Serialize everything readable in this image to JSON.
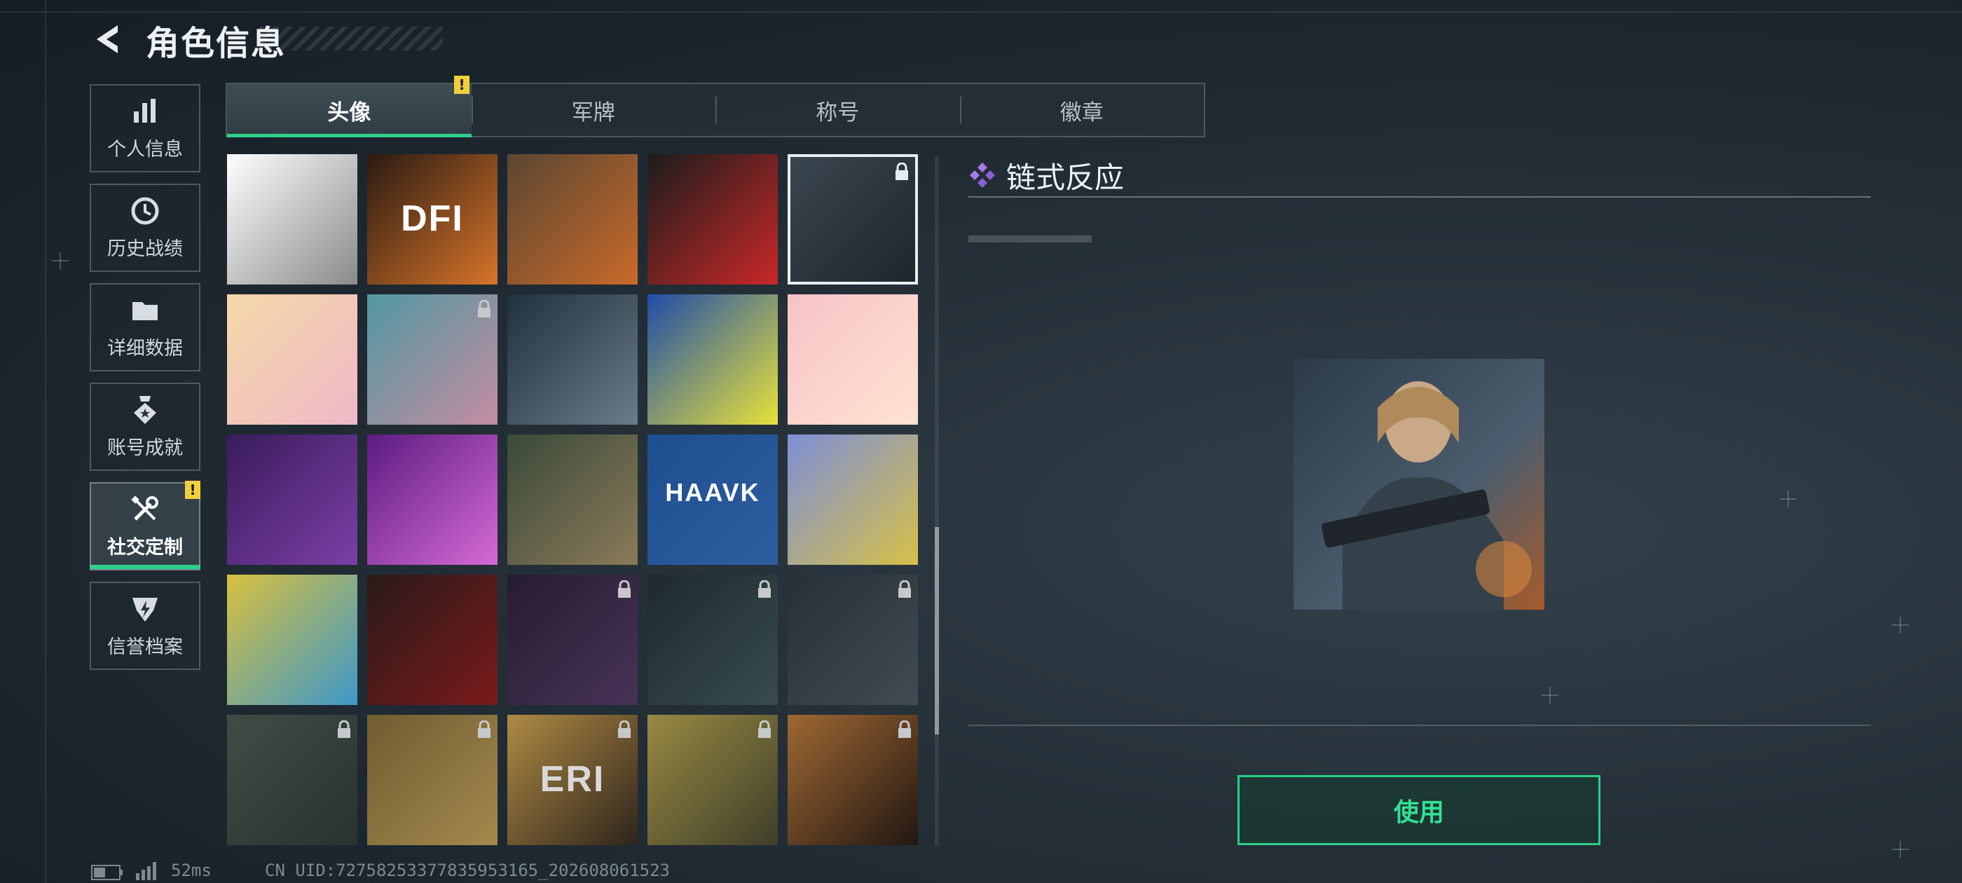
{
  "header": {
    "title": "角色信息",
    "back_icon": "back-arrow-icon"
  },
  "sidebar": {
    "items": [
      {
        "label": "个人信息",
        "icon": "bar-chart-icon",
        "active": false
      },
      {
        "label": "历史战绩",
        "icon": "clock-history-icon",
        "active": false
      },
      {
        "label": "详细数据",
        "icon": "folder-icon",
        "active": false
      },
      {
        "label": "账号成就",
        "icon": "medal-icon",
        "active": false
      },
      {
        "label": "社交定制",
        "icon": "wrench-screwdriver-icon",
        "active": true,
        "alert": "!"
      },
      {
        "label": "信誉档案",
        "icon": "shield-badge-icon",
        "active": false
      }
    ]
  },
  "tabs": [
    {
      "label": "头像",
      "active": true,
      "alert": "!"
    },
    {
      "label": "军牌",
      "active": false
    },
    {
      "label": "称号",
      "active": false
    },
    {
      "label": "徽章",
      "active": false
    }
  ],
  "avatars": [
    {
      "name": "sketch-character",
      "locked": false,
      "selected": false,
      "text": ""
    },
    {
      "name": "dfi-logo",
      "locked": false,
      "selected": false,
      "text": "DFI"
    },
    {
      "name": "soldier-headset",
      "locked": false,
      "selected": false,
      "text": ""
    },
    {
      "name": "man-ok-gesture",
      "locked": false,
      "selected": false,
      "text": ""
    },
    {
      "name": "chain-reaction-operator",
      "locked": true,
      "selected": true,
      "text": ""
    },
    {
      "name": "chibi-sandcastle",
      "locked": false,
      "selected": false,
      "text": ""
    },
    {
      "name": "chibi-float-ring",
      "locked": true,
      "selected": false,
      "text": ""
    },
    {
      "name": "agent-soldier",
      "locked": false,
      "selected": false,
      "text": ""
    },
    {
      "name": "neon-hero",
      "locked": false,
      "selected": false,
      "text": ""
    },
    {
      "name": "chibi-laptop",
      "locked": false,
      "selected": false,
      "text": ""
    },
    {
      "name": "man-glasses-purple",
      "locked": false,
      "selected": false,
      "text": ""
    },
    {
      "name": "woman-goggles-purple",
      "locked": false,
      "selected": false,
      "text": ""
    },
    {
      "name": "white-eagle-emblem",
      "locked": false,
      "selected": false,
      "text": ""
    },
    {
      "name": "haavk-logo",
      "locked": false,
      "selected": false,
      "text": "HAAVK"
    },
    {
      "name": "mascot-sticker",
      "locked": false,
      "selected": false,
      "text": ""
    },
    {
      "name": "octopus-wave",
      "locked": false,
      "selected": false,
      "text": ""
    },
    {
      "name": "jigsaw-puppet",
      "locked": false,
      "selected": false,
      "text": ""
    },
    {
      "name": "purple-agent",
      "locked": true,
      "selected": false,
      "text": ""
    },
    {
      "name": "masked-soldier",
      "locked": true,
      "selected": false,
      "text": ""
    },
    {
      "name": "star-gear-emblem",
      "locked": true,
      "selected": false,
      "text": ""
    },
    {
      "name": "helicopter-scene",
      "locked": true,
      "selected": false,
      "text": ""
    },
    {
      "name": "tribal-mask-sticker",
      "locked": true,
      "selected": false,
      "text": ""
    },
    {
      "name": "eri-logo",
      "locked": true,
      "selected": false,
      "text": "ERI"
    },
    {
      "name": "man-glasses-yellow",
      "locked": true,
      "selected": false,
      "text": ""
    },
    {
      "name": "fire-explosion",
      "locked": true,
      "selected": false,
      "text": ""
    }
  ],
  "panel": {
    "title": "链式反应",
    "button": "使用"
  },
  "status": {
    "ping": "52ms",
    "uid": "CN UID:7275825337783595316​5_202608061523"
  },
  "colors": {
    "accent": "#2fd08a",
    "warn": "#f2cf3c",
    "diamond": "#9b6ae0"
  }
}
